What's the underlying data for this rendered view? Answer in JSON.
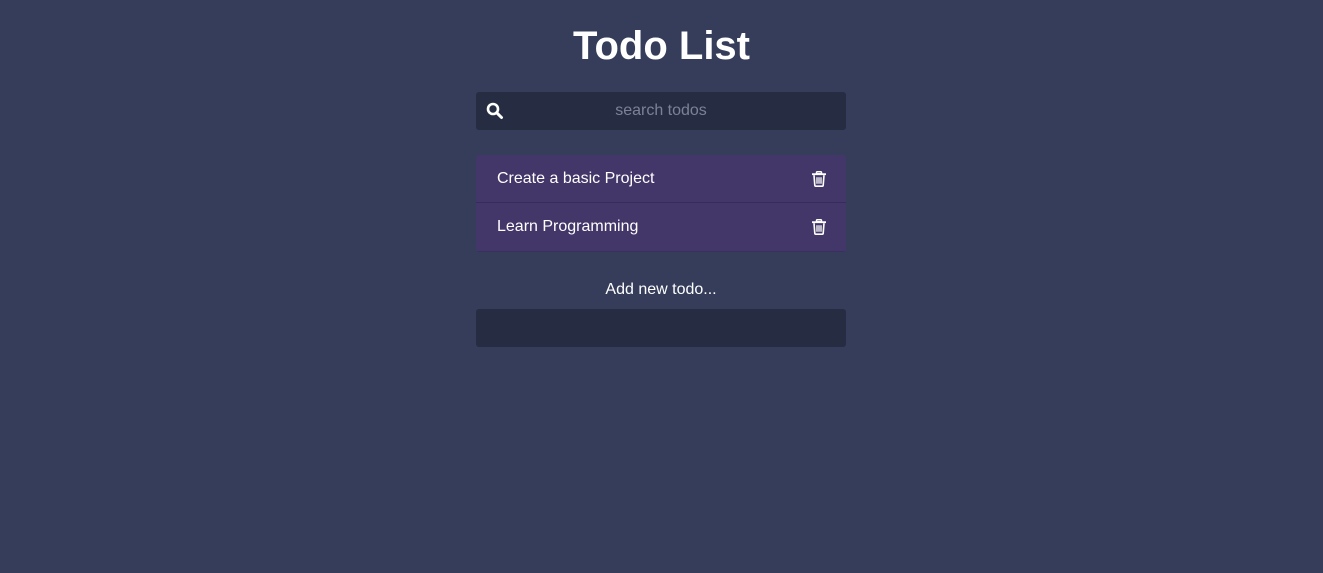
{
  "header": {
    "title": "Todo List"
  },
  "search": {
    "placeholder": "search todos",
    "value": "",
    "icon": "search-icon"
  },
  "todos": [
    {
      "text": "Create a basic Project",
      "icon": "trash-icon"
    },
    {
      "text": "Learn Programming",
      "icon": "trash-icon"
    }
  ],
  "add_todo": {
    "label": "Add new todo...",
    "value": ""
  },
  "colors": {
    "background": "#353d5b",
    "input_background": "#262d42",
    "todo_background": "#433669",
    "text": "#ffffff",
    "placeholder": "#7d8197"
  }
}
